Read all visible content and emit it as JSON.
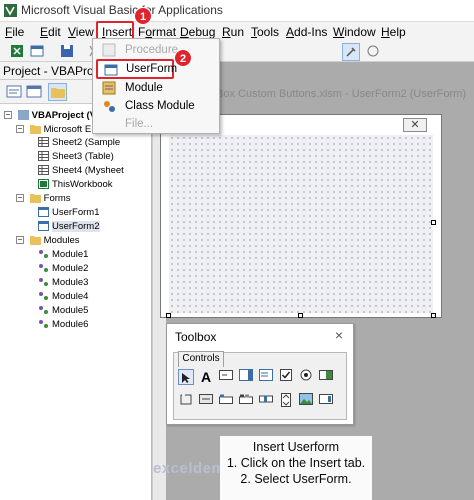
{
  "window": {
    "title": "Microsoft Visual Basic for Applications"
  },
  "menu": {
    "items": [
      {
        "label": "File",
        "u": "F"
      },
      {
        "label": "Edit",
        "u": "E"
      },
      {
        "label": "View",
        "u": "V"
      },
      {
        "label": "Insert",
        "u": "I"
      },
      {
        "label": "Format",
        "u": "o"
      },
      {
        "label": "Debug",
        "u": "D"
      },
      {
        "label": "Run",
        "u": "R"
      },
      {
        "label": "Tools",
        "u": "T"
      },
      {
        "label": "Add-Ins",
        "u": "A"
      },
      {
        "label": "Window",
        "u": "W"
      },
      {
        "label": "Help",
        "u": "H"
      }
    ]
  },
  "insert_menu": {
    "items": [
      {
        "label": "Procedure...",
        "enabled": false,
        "icon": "procedure-icon"
      },
      {
        "label": "UserForm",
        "enabled": true,
        "icon": "userform-icon"
      },
      {
        "label": "Module",
        "enabled": true,
        "icon": "module-icon"
      },
      {
        "label": "Class Module",
        "enabled": true,
        "icon": "class-module-icon"
      },
      {
        "label": "File...",
        "enabled": false,
        "icon": ""
      }
    ]
  },
  "steps": {
    "one": "1",
    "two": "2"
  },
  "project": {
    "title": "Project - VBAProject",
    "tree": {
      "root": "VBAProject (V",
      "excel_objects": "Microsoft E",
      "sheets": [
        "Sheet2 (Sample",
        "Sheet3 (Table)",
        "Sheet4 (Mysheet"
      ],
      "workbook": "ThisWorkbook",
      "forms_folder": "Forms",
      "forms": [
        "UserForm1",
        "UserForm2"
      ],
      "modules_folder": "Modules",
      "modules": [
        "Module1",
        "Module2",
        "Module3",
        "Module4",
        "Module5",
        "Module6"
      ]
    }
  },
  "userform": {
    "window_title": "Box Custom Buttons.xlsm - UserForm2 (UserForm)",
    "close_glyph": "✕"
  },
  "toolbox": {
    "title": "Toolbox",
    "tab": "Controls",
    "close_glyph": "×"
  },
  "caption": {
    "line1": "Insert Userform",
    "line2": "1. Click on the Insert tab.",
    "line3": "2. Select UserForm."
  },
  "watermark": "exceldemy",
  "colors": {
    "highlight": "#e0242c",
    "selection": "#d8e6f7"
  }
}
